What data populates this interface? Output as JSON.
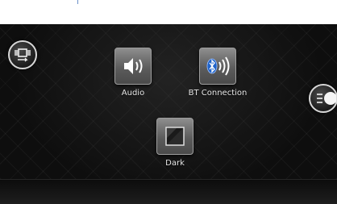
{
  "tiles": {
    "audio": {
      "label": "Audio",
      "icon": "speaker-icon"
    },
    "bt": {
      "label": "BT Connection",
      "icon": "bluetooth-speaker-icon"
    },
    "dark": {
      "label": "Dark",
      "icon": "dark-mode-icon"
    }
  },
  "controls": {
    "left_button": {
      "icon": "screen-mode-icon"
    },
    "right_button": {
      "icon": "menu-icon"
    }
  },
  "colors": {
    "background": "#0e0e0e",
    "tile": "#6f6f6f",
    "bluetooth": "#1f63c9",
    "label": "#e8e8e8"
  }
}
